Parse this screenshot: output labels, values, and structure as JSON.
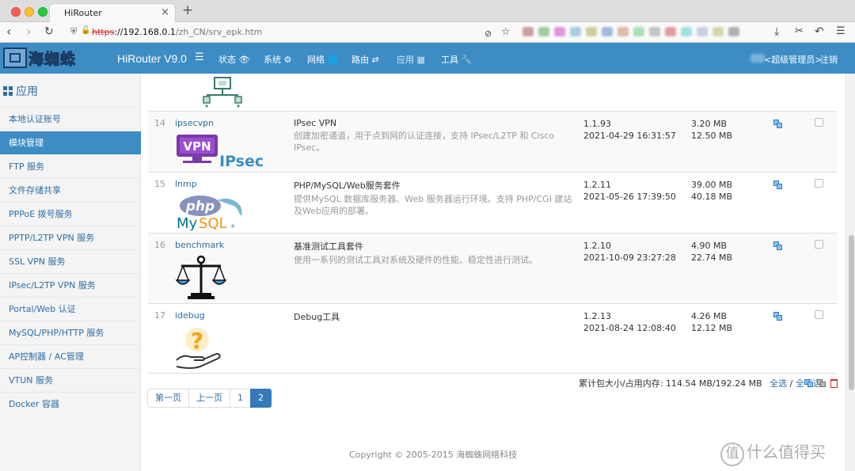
{
  "browser": {
    "tab_title": "HiRouter",
    "tab_close": "×",
    "new_tab": "+",
    "url_scheme": "https",
    "url_host": "://192.168.0.1",
    "url_path": "/zh_CN/srv_epk.htm",
    "ext_colors": [
      "#a55",
      "#5a5",
      "#c4c",
      "#6ac",
      "#aa5",
      "#58c",
      "#c86",
      "#6c8",
      "#999",
      "#c55",
      "#5cc",
      "#aac",
      "#bb6",
      "#777"
    ]
  },
  "header": {
    "logo_text": "海蜘蛛",
    "title": "HiRouter V9.0",
    "menu": [
      {
        "label": "状态 👁",
        "dim": false
      },
      {
        "label": "系统 ⚙",
        "dim": false
      },
      {
        "label": "网络 🌐",
        "dim": false
      },
      {
        "label": "路由 ⇄",
        "dim": false
      },
      {
        "label": "应用 ▦",
        "dim": true
      },
      {
        "label": "工具 🔧",
        "dim": false
      }
    ],
    "user": "<超级管理员>",
    "logout": "注销"
  },
  "sidebar": {
    "heading": "应用",
    "items": [
      {
        "label": "本地认证账号",
        "active": false
      },
      {
        "label": "模块管理",
        "active": true
      },
      {
        "label": "FTP 服务",
        "active": false
      },
      {
        "label": "文件存储共享",
        "active": false
      },
      {
        "label": "PPPoE 拨号服务",
        "active": false
      },
      {
        "label": "PPTP/L2TP VPN 服务",
        "active": false
      },
      {
        "label": "SSL VPN 服务",
        "active": false
      },
      {
        "label": "IPsec/L2TP VPN 服务",
        "active": false
      },
      {
        "label": "Portal/Web 认证",
        "active": false
      },
      {
        "label": "MySQL/PHP/HTTP 服务",
        "active": false
      },
      {
        "label": "AP控制器 / AC管理",
        "active": false
      },
      {
        "label": "VTUN 服务",
        "active": false
      },
      {
        "label": "Docker 容器",
        "active": false
      }
    ]
  },
  "modules": [
    {
      "num": "14",
      "name": "ipsecvpn",
      "logo": "vpn-ipsec",
      "title": "IPsec VPN",
      "desc": "创建加密通道，用于点到网的认证连接，支持 IPsec/L2TP 和 Cisco IPsec。",
      "version": "1.1.93",
      "date": "2021-04-29 16:31:57",
      "size1": "3.20 MB",
      "size2": "12.50 MB"
    },
    {
      "num": "15",
      "name": "lnmp",
      "logo": "php-mysql",
      "title": "PHP/MySQL/Web服务套件",
      "desc": "提供MySQL 数据库服务器、Web 服务器运行环境。支持 PHP/CGI 建站及Web应用的部署。",
      "version": "1.2.11",
      "date": "2021-05-26 17:39:50",
      "size1": "39.00 MB",
      "size2": "40.18 MB"
    },
    {
      "num": "16",
      "name": "benchmark",
      "logo": "scales",
      "title": "基准测试工具套件",
      "desc": "使用一系列的测试工具对系统及硬件的性能、稳定性进行测试。",
      "version": "1.2.10",
      "date": "2021-10-09 23:27:28",
      "size1": "4.90 MB",
      "size2": "22.74 MB"
    },
    {
      "num": "17",
      "name": "idebug",
      "logo": "question-hand",
      "title": "Debug工具",
      "desc": "",
      "version": "1.2.13",
      "date": "2021-08-24 12:08:40",
      "size1": "4.26 MB",
      "size2": "12.12 MB"
    }
  ],
  "summary": {
    "text": "累计包大小/占用内存: 114.54 MB/192.24 MB",
    "select_all": "全选",
    "separator": "/",
    "select_none": "全不选"
  },
  "pagination": [
    {
      "label": "第一页",
      "active": false
    },
    {
      "label": "上一页",
      "active": false
    },
    {
      "label": "1",
      "active": false
    },
    {
      "label": "2",
      "active": true
    }
  ],
  "footer": "Copyright © 2005-2015 海蜘蛛网络科技",
  "watermark": {
    "circle": "值",
    "text": "什么值得买"
  }
}
